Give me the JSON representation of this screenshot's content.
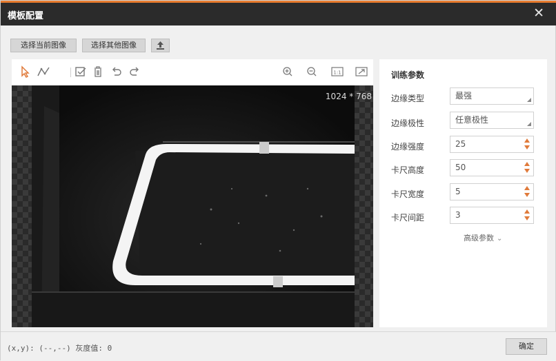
{
  "dialog": {
    "title": "模板配置",
    "close_icon": "close-icon"
  },
  "actions": {
    "select_current_image": "选择当前图像",
    "select_other_image": "选择其他图像",
    "upload_icon": "upload-icon"
  },
  "toolbar": {
    "tools": [
      "pointer-icon",
      "polyline-icon",
      "checkbox-select-icon",
      "delete-icon",
      "undo-icon",
      "redo-icon"
    ],
    "zoom_tools": [
      "zoom-in-icon",
      "zoom-out-icon",
      "actual-size-icon",
      "fit-window-icon"
    ],
    "actual_size_label": "1:1"
  },
  "viewer": {
    "resolution": "1024 * 768"
  },
  "params": {
    "header": "训练参数",
    "rows": [
      {
        "label": "边缘类型",
        "value": "最强",
        "kind": "select"
      },
      {
        "label": "边缘极性",
        "value": "任意极性",
        "kind": "select"
      },
      {
        "label": "边缘强度",
        "value": "25",
        "kind": "spin"
      },
      {
        "label": "卡尺高度",
        "value": "50",
        "kind": "spin"
      },
      {
        "label": "卡尺宽度",
        "value": "5",
        "kind": "spin"
      },
      {
        "label": "卡尺间距",
        "value": "3",
        "kind": "spin"
      }
    ],
    "advanced_label": "高级参数"
  },
  "status": {
    "coords": "(x,y): (--,--) 灰度值: 0"
  },
  "footer": {
    "confirm_label": "确定"
  },
  "colors": {
    "accent": "#e07a3a",
    "titlebar": "#2b2b2b"
  }
}
